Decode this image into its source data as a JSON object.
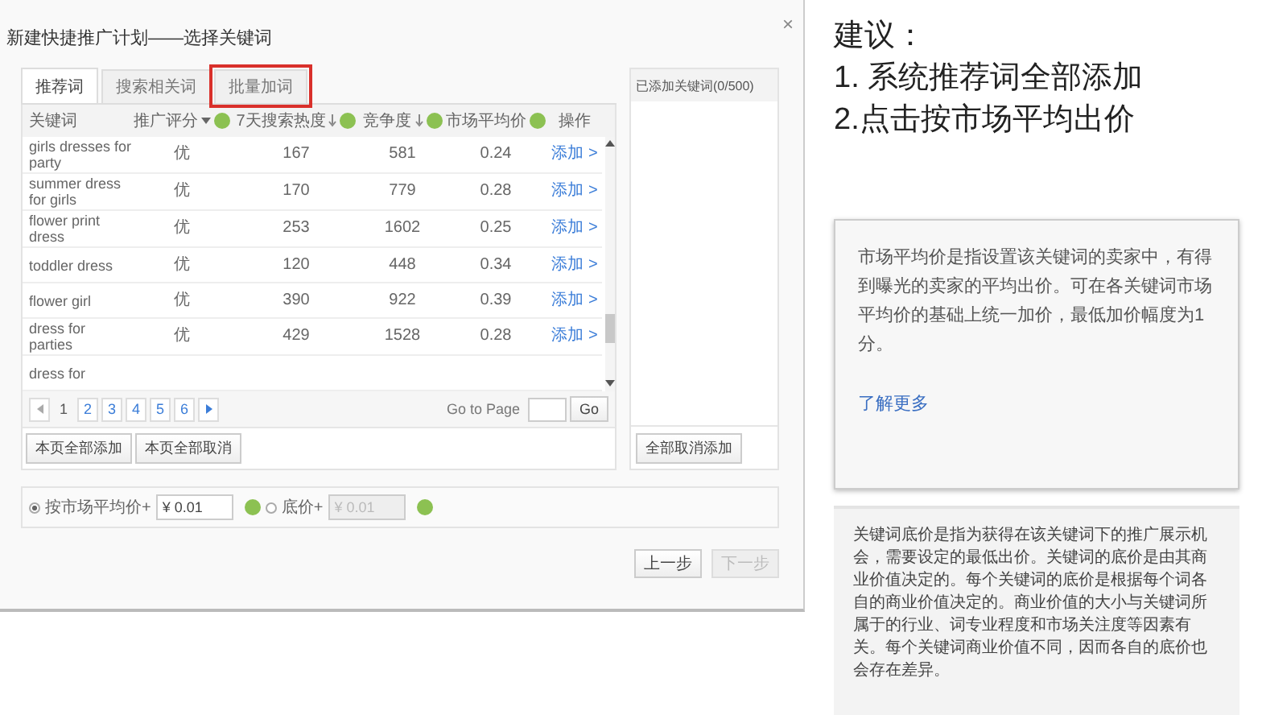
{
  "dialog": {
    "title": "新建快捷推广计划——选择关键词",
    "close": "×"
  },
  "tabs": [
    {
      "label": "推荐词",
      "selected": true,
      "highlighted": false
    },
    {
      "label": "搜索相关词",
      "selected": false,
      "highlighted": false
    },
    {
      "label": "批量加词",
      "selected": false,
      "highlighted": true
    }
  ],
  "table": {
    "columns": [
      {
        "label": "关键词",
        "sort_menu": false,
        "sort_down": false,
        "help": false
      },
      {
        "label": "推广评分",
        "sort_menu": true,
        "sort_down": false,
        "help": true
      },
      {
        "label": "7天搜索热度",
        "sort_menu": false,
        "sort_down": true,
        "help": true
      },
      {
        "label": "竞争度",
        "sort_menu": false,
        "sort_down": true,
        "help": true
      },
      {
        "label": "市场平均价",
        "sort_menu": false,
        "sort_down": false,
        "help": true
      },
      {
        "label": "操作",
        "sort_menu": false,
        "sort_down": false,
        "help": false
      }
    ],
    "rows": [
      {
        "keyword": "girls dresses for party",
        "score": "优",
        "heat": "167",
        "competition": "581",
        "avg_price": "0.24",
        "action": "添加 >"
      },
      {
        "keyword": "summer dress for girls",
        "score": "优",
        "heat": "170",
        "competition": "779",
        "avg_price": "0.28",
        "action": "添加 >"
      },
      {
        "keyword": "flower print dress",
        "score": "优",
        "heat": "253",
        "competition": "1602",
        "avg_price": "0.25",
        "action": "添加 >"
      },
      {
        "keyword": "toddler dress",
        "score": "优",
        "heat": "120",
        "competition": "448",
        "avg_price": "0.34",
        "action": "添加 >"
      },
      {
        "keyword": "flower girl",
        "score": "优",
        "heat": "390",
        "competition": "922",
        "avg_price": "0.39",
        "action": "添加 >"
      },
      {
        "keyword": "dress for parties",
        "score": "优",
        "heat": "429",
        "competition": "1528",
        "avg_price": "0.28",
        "action": "添加 >"
      },
      {
        "keyword": "dress for",
        "score": "",
        "heat": "",
        "competition": "",
        "avg_price": "",
        "action": ""
      }
    ]
  },
  "pagination": {
    "pages": [
      {
        "label": "1",
        "selected": true
      },
      {
        "label": "2",
        "selected": false
      },
      {
        "label": "3",
        "selected": false
      },
      {
        "label": "4",
        "selected": false
      },
      {
        "label": "5",
        "selected": false
      },
      {
        "label": "6",
        "selected": false
      }
    ],
    "goto_label": "Go to Page",
    "go": "Go"
  },
  "page_buttons": [
    "本页全部添加",
    "本页全部取消"
  ],
  "added_panel": {
    "title": "已添加关键词(0/500)",
    "button": "全部取消添加"
  },
  "bid": {
    "options": [
      {
        "label": "按市场平均价+",
        "selected": true,
        "value": "¥ 0.01",
        "disabled": false
      },
      {
        "label": "底价+",
        "selected": false,
        "value": "¥ 0.01",
        "disabled": true
      }
    ]
  },
  "footer_buttons": [
    {
      "label": "上一步",
      "disabled": false
    },
    {
      "label": "下一步",
      "disabled": true
    }
  ],
  "advice": {
    "title": "建议：",
    "lines": [
      "1. 系统推荐词全部添加",
      "2.点击按市场平均出价"
    ]
  },
  "tooltip": {
    "text": "市场平均价是指设置该关键词的卖家中，有得到曝光的卖家的平均出价。可在各关键词市场平均价的基础上统一加价，最低加价幅度为1分。",
    "link": "了解更多"
  },
  "note": {
    "text": "关键词底价是指为获得在该关键词下的推广展示机会，需要设定的最低出价。关键词的底价是由其商业价值决定的。每个关键词的底价是根据每个词各自的商业价值决定的。商业价值的大小与关键词所属于的行业、词专业程度和市场关注度等因素有关。每个关键词商业价值不同，因而各自的底价也会存在差异。"
  }
}
